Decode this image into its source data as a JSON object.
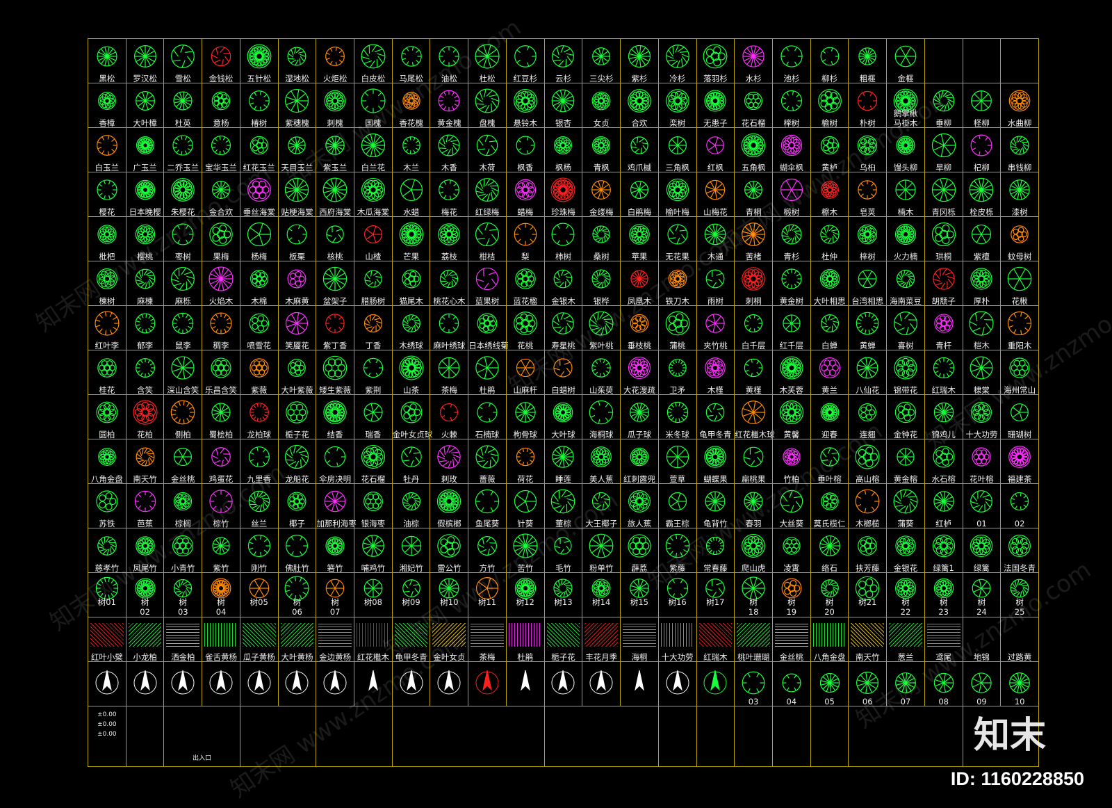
{
  "rows": [
    [
      "黑松",
      "罗汉松",
      "雪松",
      "金钱松",
      "五针松",
      "湿地松",
      "火炬松",
      "白皮松",
      "马尾松",
      "油松",
      "杜松",
      "红豆杉",
      "云杉",
      "三尖杉",
      "紫杉",
      "冷杉",
      "落羽杉",
      "水杉",
      "池杉",
      "柳杉",
      "粗榧",
      "金榧",
      "",
      "",
      ""
    ],
    [
      "香樟",
      "大叶樟",
      "杜英",
      "意杨",
      "椿树",
      "紫穗槐",
      "刺槐",
      "国槐",
      "香花槐",
      "黄金槐",
      "盘槐",
      "悬铃木",
      "银杏",
      "女贞",
      "合欢",
      "栾树",
      "无患子",
      "花石榴",
      "榉树",
      "榆树",
      "朴树",
      "马褂木",
      "垂柳",
      "柽柳",
      "水曲柳"
    ],
    [
      "白玉兰",
      "广玉兰",
      "二乔玉兰",
      "宝华玉兰",
      "红花玉兰",
      "天目玉兰",
      "紫玉兰",
      "白兰花",
      "木兰",
      "木香",
      "木荷",
      "枫香",
      "枫杨",
      "青枫",
      "鸡爪槭",
      "三角枫",
      "红枫",
      "五角枫",
      "蝴伞枫",
      "黄栌",
      "乌桕",
      "馒头柳",
      "旱柳",
      "杞柳",
      "串钱柳"
    ],
    [
      "樱花",
      "日本晚樱",
      "朱樱花",
      "金合欢",
      "垂丝海棠",
      "贴梗海棠",
      "西府海棠",
      "木瓜海棠",
      "水蜡",
      "梅花",
      "红绿梅",
      "蜡梅",
      "珍珠梅",
      "金缕梅",
      "白鹃梅",
      "榆叶梅",
      "山梅花",
      "青桐",
      "椴树",
      "檫木",
      "皂荚",
      "楠木",
      "青冈栎",
      "栓皮栎",
      "漆树"
    ],
    [
      "枇杷",
      "樱桃",
      "枣树",
      "果梅",
      "杨梅",
      "板栗",
      "核桃",
      "山楂",
      "芒果",
      "荔枝",
      "柑桔",
      "梨",
      "柿树",
      "桑树",
      "苹果",
      "无花果",
      "木通",
      "苦楮",
      "青杉",
      "杜仲",
      "梓树",
      "火力楠",
      "珙桐",
      "紫檀",
      "蚊母树"
    ],
    [
      "楝树",
      "麻楝",
      "麻栎",
      "火焰木",
      "木棉",
      "木麻黄",
      "盆架子",
      "腊肠树",
      "猫尾木",
      "桃花心木",
      "蓝果树",
      "蓝花楹",
      "金银木",
      "银桦",
      "凤凰木",
      "铁刀木",
      "雨树",
      "刺桐",
      "黄金树",
      "大叶相思",
      "台湾相思",
      "海南菜豆",
      "胡颓子",
      "厚朴",
      "花楸"
    ],
    [
      "红叶李",
      "郁李",
      "鼠李",
      "稠李",
      "喷雪花",
      "笑靥花",
      "紫丁香",
      "丁香",
      "木绣球",
      "麻叶绣球",
      "日本绣线菊",
      "花桃",
      "寿星桃",
      "紫叶桃",
      "垂枝桃",
      "蒲桃",
      "夹竹桃",
      "白千层",
      "红千层",
      "白蝉",
      "黄蝉",
      "喜树",
      "青杆",
      "桤木",
      "重阳木"
    ],
    [
      "桂花",
      "含笑",
      "深山含笑",
      "乐昌含笑",
      "紫薇",
      "大叶紫薇",
      "矮生紫薇",
      "紫荆",
      "山茶",
      "茶梅",
      "杜鹃",
      "山麻杆",
      "白蜡树",
      "山茱萸",
      "大花溲疏",
      "卫矛",
      "木槿",
      "黄槿",
      "木芙蓉",
      "黄兰",
      "八仙花",
      "锦带花",
      "红瑞木",
      "棣棠",
      "海州常山"
    ],
    [
      "圆柏",
      "花柏",
      "侧柏",
      "蜀桧柏",
      "龙柏球",
      "栀子花",
      "结香",
      "瑞香",
      "金叶女贞球",
      "火棘",
      "石楠球",
      "枸骨球",
      "大叶球",
      "海桐球",
      "瓜子球",
      "米冬球",
      "龟甲冬青",
      "红花檵木球",
      "黄馨",
      "迎春",
      "连翘",
      "金钟花",
      "锦鸡儿",
      "十大功劳",
      "珊瑚树"
    ],
    [
      "八角金盘",
      "南天竹",
      "金丝桃",
      "鸡蛋花",
      "九里香",
      "龙船花",
      "伞房决明",
      "花石榴",
      "牡丹",
      "刺玫",
      "蔷薇",
      "荷花",
      "睡莲",
      "美人蕉",
      "红刺露兜",
      "萱草",
      "蝴蝶果",
      "扁桃果",
      "竹柏",
      "垂叶榕",
      "高山榕",
      "黄金榕",
      "水石榕",
      "花叶榕",
      "福建茶"
    ],
    [
      "苏铁",
      "芭蕉",
      "棕榈",
      "棕竹",
      "丝兰",
      "椰子",
      "加那利海枣",
      "银海枣",
      "油棕",
      "假槟榔",
      "鱼尾葵",
      "针葵",
      "董棕",
      "大王椰子",
      "旅人蕉",
      "霸王棕",
      "龟背竹",
      "春羽",
      "大丝葵",
      "莫氏榄仁",
      "木榔榄",
      "蒲葵",
      "红栌",
      "01",
      "02"
    ],
    [
      "慈孝竹",
      "凤尾竹",
      "小青竹",
      "紫竹",
      "刚竹",
      "佛肚竹",
      "箬竹",
      "哺鸡竹",
      "湘妃竹",
      "雷公竹",
      "方竹",
      "苦竹",
      "毛竹",
      "粉单竹",
      "薜荔",
      "紫藤",
      "常春藤",
      "爬山虎",
      "凌霄",
      "络石",
      "扶芳藤",
      "金银花",
      "绿篱1",
      "绿篱",
      "法国冬青"
    ],
    [
      "树01",
      "树02",
      "树03",
      "树04",
      "树05",
      "树06",
      "树07",
      "树08",
      "树09",
      "树10",
      "树11",
      "树12",
      "树13",
      "树14",
      "树15",
      "树16",
      "树17",
      "树18",
      "树19",
      "树20",
      "树21",
      "树22",
      "树23",
      "树24",
      "树25"
    ],
    [
      "红叶小檗",
      "小龙柏",
      "洒金柏",
      "雀舌黄杨",
      "瓜子黄杨",
      "大叶黄杨",
      "金边黄杨",
      "红花檵木",
      "龟甲冬青",
      "金叶女贞",
      "茶梅",
      "杜鹃",
      "栀子花",
      "丰花月季",
      "海桐",
      "十大功劳",
      "红瑞木",
      "桃叶珊瑚",
      "金丝桃",
      "八角金盘",
      "南天竹",
      "葱兰",
      "鸢尾",
      "地锦",
      "过路黄"
    ]
  ],
  "extra_label": "鹅掌楸",
  "row13_tops": [
    "",
    "02",
    "03",
    "04",
    "",
    "06",
    "07",
    "",
    "",
    "",
    "",
    "",
    "",
    "",
    "",
    "",
    "",
    "18",
    "19",
    "20",
    "",
    "22",
    "23",
    "24",
    "25"
  ],
  "row13_bottoms": [
    "树01",
    "树",
    "树",
    "树",
    "树05",
    "树",
    "树",
    "树08",
    "树09",
    "树10",
    "树11",
    "树12",
    "树13",
    "树14",
    "树15",
    "树16",
    "树17",
    "树",
    "树",
    "树",
    "树21",
    "树",
    "树",
    "树",
    "树"
  ],
  "row15_numbers": [
    "03",
    "04",
    "05",
    "06",
    "07",
    "08",
    "09",
    "10"
  ],
  "legend_small": [
    "±0.00",
    "±0.00",
    "±0.00",
    "出入口"
  ],
  "watermark_text": "知末网 www.znzmo.com",
  "logo": "知末",
  "image_id": "ID: 1160228850",
  "colors": {
    "grid": "#b9a400",
    "primary": "#19ff3c",
    "magenta": "#ff2fff",
    "orange": "#ff8a00",
    "red": "#ff2020",
    "yellow": "#ffd400",
    "white": "#ffffff"
  }
}
